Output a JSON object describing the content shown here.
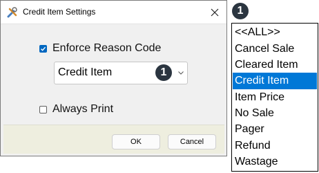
{
  "dialog": {
    "title": "Credit Item Settings",
    "enforce_reason_label": "Enforce Reason Code",
    "enforce_reason_checked": true,
    "reason_select_value": "Credit Item",
    "always_print_label": "Always Print",
    "always_print_checked": false,
    "ok_label": "OK",
    "cancel_label": "Cancel",
    "callout_number": "1"
  },
  "dropdown": {
    "callout_number": "1",
    "options": [
      {
        "label": "<<ALL>>",
        "selected": false
      },
      {
        "label": "Cancel Sale",
        "selected": false
      },
      {
        "label": "Cleared Item",
        "selected": false
      },
      {
        "label": "Credit Item",
        "selected": true
      },
      {
        "label": "Item Price",
        "selected": false
      },
      {
        "label": "No Sale",
        "selected": false
      },
      {
        "label": "Pager",
        "selected": false
      },
      {
        "label": "Refund",
        "selected": false
      },
      {
        "label": "Wastage",
        "selected": false
      }
    ]
  },
  "colors": {
    "accent": "#0067c0",
    "selection": "#0078d7",
    "callout": "#2b3540",
    "footer": "#eeeedf"
  }
}
